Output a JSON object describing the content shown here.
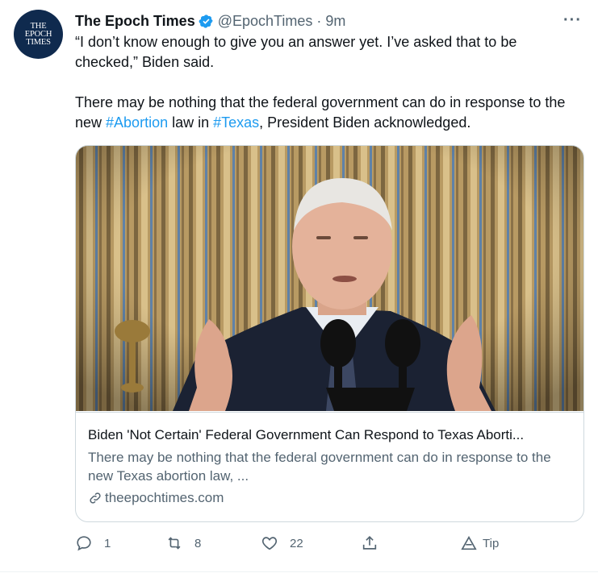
{
  "avatar": {
    "line1": "THE",
    "line2": "EPOCH",
    "line3": "TIMES"
  },
  "author": {
    "name": "The Epoch Times",
    "handle": "@EpochTimes",
    "separator": "·",
    "time": "9m",
    "more": "···"
  },
  "tweet": {
    "paragraph1": "“I don’t know enough to give you an answer yet. I’ve asked that to be checked,” Biden said.",
    "p2_part1": "There may be nothing that the federal government can do in response to the new ",
    "hashtag1": "#Abortion",
    "p2_part2": " law in ",
    "hashtag2": "#Texas",
    "p2_part3": ", President Biden acknowledged."
  },
  "card": {
    "title": "Biden 'Not Certain' Federal Government Can Respond to Texas Aborti...",
    "description": "There may be nothing that the federal government can do in response to the new Texas abortion law, ...",
    "domain": "theepochtimes.com"
  },
  "actions": {
    "reply_count": "1",
    "retweet_count": "8",
    "like_count": "22",
    "tip_label": "Tip"
  },
  "colors": {
    "accent": "#1d9bf0",
    "muted": "#536471",
    "text": "#0f1419",
    "avatar_bg": "#0f2a4e"
  }
}
